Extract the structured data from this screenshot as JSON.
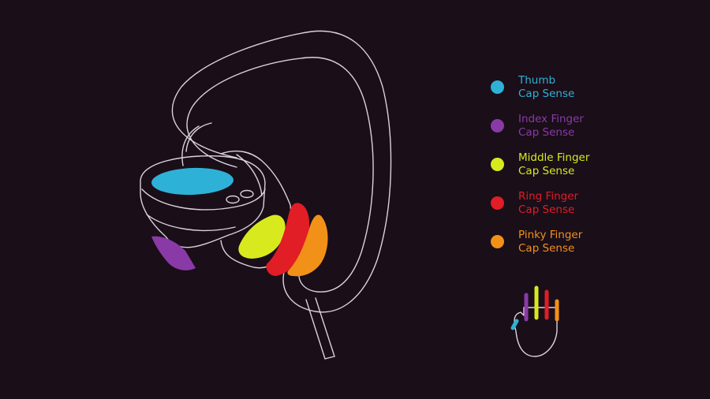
{
  "colors": {
    "background": "#1a0e19",
    "outline": "#d9d3dc",
    "thumb": "#2eb1d6",
    "index": "#8a3aa6",
    "middle": "#d8ea1e",
    "ring": "#e11d26",
    "pinky": "#f29118"
  },
  "legend": {
    "items": [
      {
        "line1": "Thumb",
        "line2": "Cap Sense",
        "color": "#2eb1d6"
      },
      {
        "line1": "Index Finger",
        "line2": "Cap Sense",
        "color": "#8a3aa6"
      },
      {
        "line1": "Middle Finger",
        "line2": "Cap Sense",
        "color": "#d8ea1e"
      },
      {
        "line1": "Ring Finger",
        "line2": "Cap Sense",
        "color": "#e11d26"
      },
      {
        "line1": "Pinky Finger",
        "line2": "Cap Sense",
        "color": "#f29118"
      }
    ]
  },
  "icons": {
    "controller": "vr-hand-controller-icon",
    "hand": "hand-icon"
  }
}
